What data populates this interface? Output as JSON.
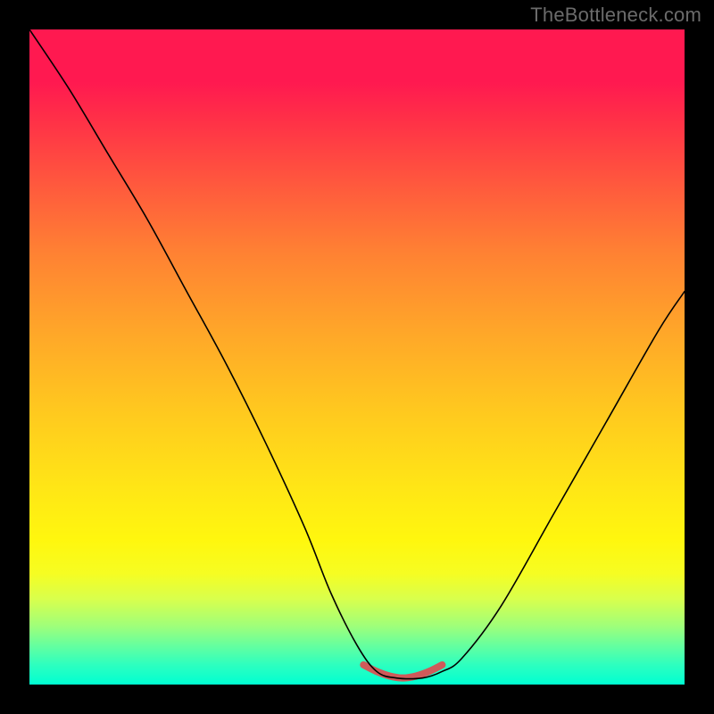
{
  "watermark": "TheBottleneck.com",
  "chart_data": {
    "type": "line",
    "title": "",
    "xlabel": "",
    "ylabel": "",
    "xlim": [
      0,
      100
    ],
    "ylim": [
      0,
      100
    ],
    "gradient": {
      "top_color": "#ff1950",
      "mid_color": "#ffe616",
      "bottom_color": "#00ffd2",
      "description": "vertical red-to-green heat gradient"
    },
    "series": [
      {
        "name": "bottleneck-curve",
        "x": [
          0,
          6,
          12,
          18,
          24,
          30,
          36,
          42,
          46,
          50,
          53,
          56,
          60,
          63,
          66,
          72,
          80,
          88,
          96,
          100
        ],
        "y": [
          100,
          91,
          81,
          71,
          60,
          49,
          37,
          24,
          14,
          6,
          2,
          1,
          1,
          2,
          4,
          12,
          26,
          40,
          54,
          60
        ]
      },
      {
        "name": "highlight-segment",
        "x": [
          51,
          53,
          55,
          57,
          59,
          61,
          63
        ],
        "y": [
          3,
          2,
          1.3,
          1,
          1.3,
          2,
          3
        ]
      }
    ],
    "annotations": []
  }
}
